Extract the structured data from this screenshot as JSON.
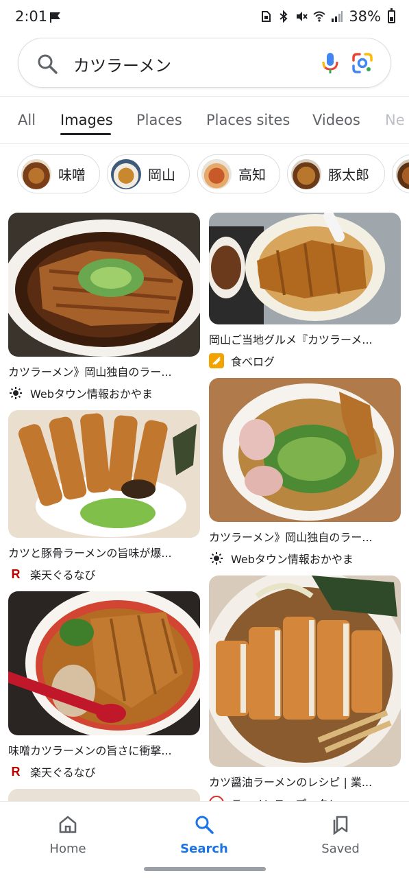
{
  "status_bar": {
    "time": "2:01",
    "battery": "38%"
  },
  "search": {
    "query": "カツラーメン"
  },
  "tabs": [
    {
      "label": "All",
      "active": false
    },
    {
      "label": "Images",
      "active": true
    },
    {
      "label": "Places",
      "active": false
    },
    {
      "label": "Places sites",
      "active": false
    },
    {
      "label": "Videos",
      "active": false
    },
    {
      "label": "Ne",
      "active": false
    }
  ],
  "chips": [
    {
      "label": "味噌"
    },
    {
      "label": "岡山"
    },
    {
      "label": "高知"
    },
    {
      "label": "豚太郎"
    }
  ],
  "results": [
    {
      "title": "カツラーメン》岡山独自のラー...",
      "source": "Webタウン情報おかやま",
      "icon": "sun-icon"
    },
    {
      "title": "岡山ご当地グルメ『カツラーメ...",
      "source": "食べログ",
      "icon": "tabelog-icon"
    },
    {
      "title": "カツと豚骨ラーメンの旨味が爆...",
      "source": "楽天ぐるなび",
      "icon": "rakuten-icon"
    },
    {
      "title": "カツラーメン》岡山独自のラー...",
      "source": "Webタウン情報おかやま",
      "icon": "sun-icon"
    },
    {
      "title": "味噌カツラーメンの旨さに衝撃...",
      "source": "楽天ぐるなび",
      "icon": "rakuten-icon"
    },
    {
      "title": "カツ醤油ラーメンのレシピ | 業...",
      "source": "ラーメンスープ・タレ.com",
      "icon": "noodle-site-icon"
    }
  ],
  "bottom_nav": [
    {
      "label": "Home",
      "icon": "home-icon",
      "active": false
    },
    {
      "label": "Search",
      "icon": "search-icon",
      "active": true
    },
    {
      "label": "Saved",
      "icon": "bookmark-icon",
      "active": false
    }
  ],
  "colors": {
    "accent_blue": "#1a73e8",
    "tabelog_orange": "#f2a300",
    "rakuten_red": "#bf0000"
  }
}
